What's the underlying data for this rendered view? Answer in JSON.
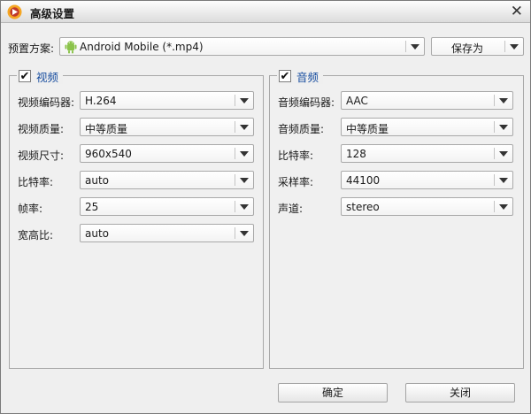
{
  "window": {
    "title": "高级设置",
    "close_glyph": "✕"
  },
  "preset": {
    "label": "预置方案:",
    "value": "Android Mobile (*.mp4)",
    "icon": "android-icon",
    "save_as": "保存为"
  },
  "video": {
    "enabled": true,
    "title": "视频",
    "fields": [
      {
        "label": "视频编码器:",
        "value": "H.264"
      },
      {
        "label": "视频质量:",
        "value": "中等质量"
      },
      {
        "label": "视频尺寸:",
        "value": "960x540"
      },
      {
        "label": "比特率:",
        "value": "auto"
      },
      {
        "label": "帧率:",
        "value": "25"
      },
      {
        "label": "宽高比:",
        "value": "auto"
      }
    ]
  },
  "audio": {
    "enabled": true,
    "title": "音频",
    "fields": [
      {
        "label": "音频编码器:",
        "value": "AAC"
      },
      {
        "label": "音频质量:",
        "value": "中等质量"
      },
      {
        "label": "比特率:",
        "value": "128"
      },
      {
        "label": "采样率:",
        "value": "44100"
      },
      {
        "label": "声道:",
        "value": "stereo"
      }
    ]
  },
  "buttons": {
    "ok": "确定",
    "close": "关闭"
  },
  "colors": {
    "group_title": "#1a4fa0",
    "window_bg": "#efefef",
    "android_green": "#8bc34a"
  }
}
